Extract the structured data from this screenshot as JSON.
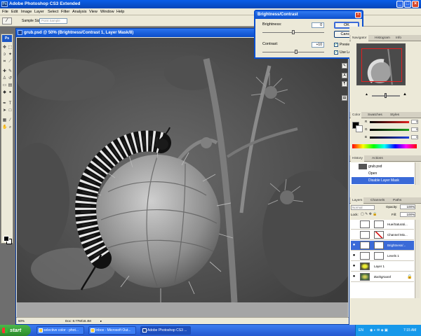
{
  "app": {
    "title": "Adobe Photoshop CS3 Extended"
  },
  "menu": [
    "File",
    "Edit",
    "Image",
    "Layer",
    "Select",
    "Filter",
    "Analysis",
    "View",
    "Window",
    "Help"
  ],
  "options": {
    "sample_size_label": "Sample Size:",
    "sample_size_value": "Point Sample"
  },
  "document": {
    "title": "grub.psd @ 50% (Brightness/Contrast 1, Layer Mask/8)",
    "zoom": "50%",
    "doc_size": "Doc: 8.77M/18.4M"
  },
  "dialog": {
    "title": "Brightness/Contrast",
    "brightness_label": "Brightness:",
    "brightness_value": "0",
    "brightness_level": 0.5,
    "contrast_label": "Contrast:",
    "contrast_value": "+10",
    "contrast_level": 0.55,
    "ok_label": "OK",
    "cancel_label": "Cancel",
    "preview_label": "Preview",
    "preview_checked": true,
    "legacy_label": "Use Legacy",
    "legacy_checked": true
  },
  "navigator": {
    "tabs": [
      "Navigator",
      "Histogram",
      "Info"
    ]
  },
  "color_panel": {
    "tabs": [
      "Color",
      "Swatches",
      "Styles"
    ],
    "channels": [
      {
        "label": "R",
        "value": "0",
        "color": "#e02020"
      },
      {
        "label": "G",
        "value": "0",
        "color": "#20a020"
      },
      {
        "label": "B",
        "value": "0",
        "color": "#2040e0"
      }
    ]
  },
  "history": {
    "tabs": [
      "History",
      "Actions"
    ],
    "snapshot": "grub.psd",
    "items": [
      "Open",
      "Disable Layer Mask"
    ],
    "selected": 1
  },
  "layers": {
    "tabs": [
      "Layers",
      "Channels",
      "Paths"
    ],
    "blend_mode": "Normal",
    "opacity_label": "Opacity:",
    "opacity_value": "100%",
    "lock_label": "Lock:",
    "fill_label": "Fill:",
    "fill_value": "100%",
    "items": [
      {
        "name": "Hue/Saturati...",
        "selected": false
      },
      {
        "name": "Channel Mix...",
        "selected": false
      },
      {
        "name": "Brightness/...",
        "selected": true
      },
      {
        "name": "Levels 1",
        "selected": false
      },
      {
        "name": "Layer 1",
        "selected": false
      },
      {
        "name": "Background",
        "selected": false
      }
    ]
  },
  "taskbar": {
    "start": "start",
    "tasks": [
      {
        "label": "selective color - phot...",
        "active": false
      },
      {
        "label": "Inbox - Microsoft Out...",
        "active": false
      },
      {
        "label": "Adobe Photoshop CS3 ...",
        "active": true
      }
    ],
    "lang": "EN",
    "time": "7:15 AM"
  }
}
